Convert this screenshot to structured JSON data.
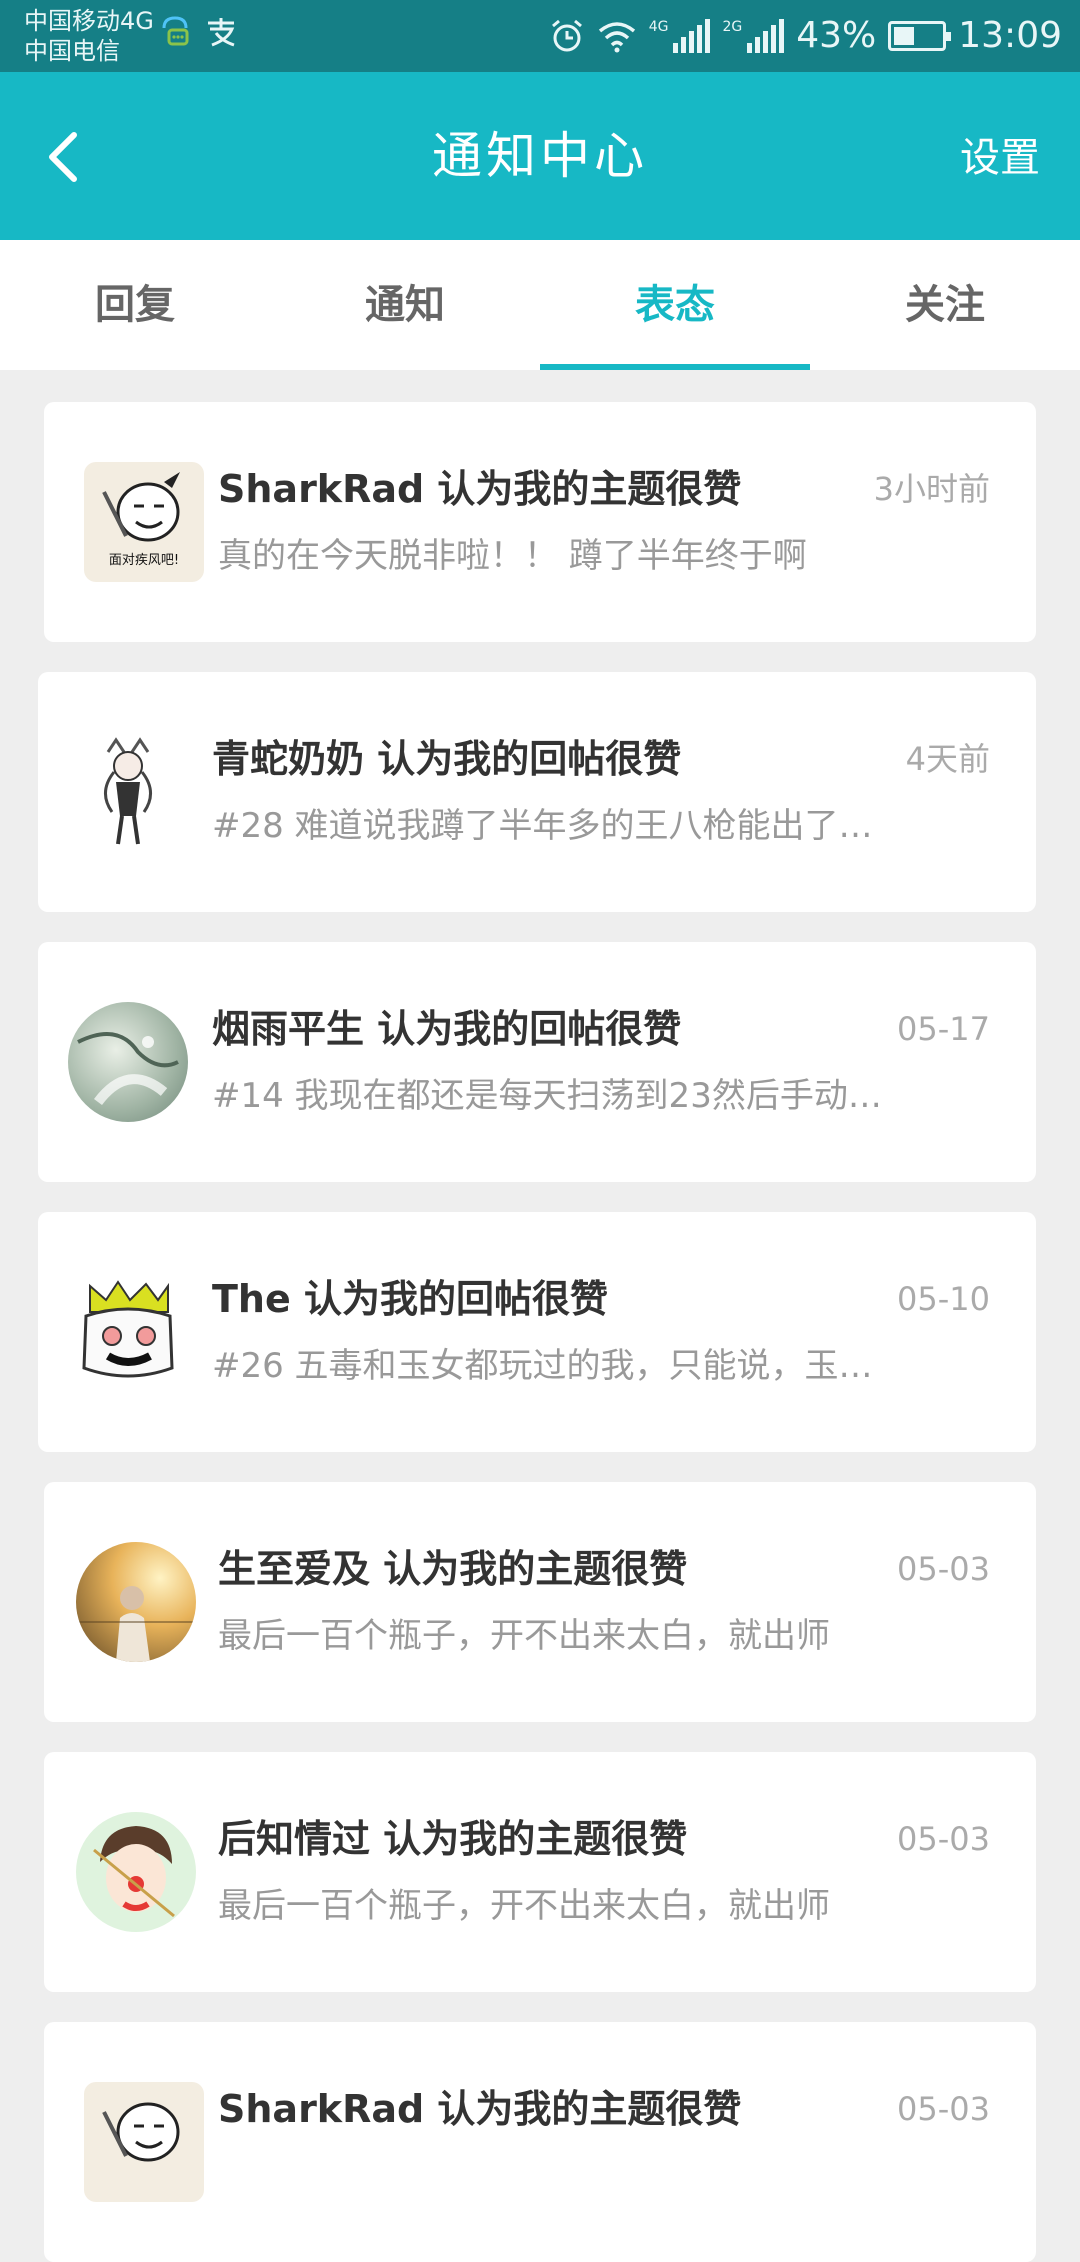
{
  "status_bar": {
    "carrier_1": "中国移动4G",
    "carrier_2": "中国电信",
    "battery": "43%",
    "time": "13:09",
    "battery_level": 0.43,
    "icons": [
      "chat-icon",
      "alipay-icon",
      "alarm-icon",
      "wifi-icon",
      "signal-4g-icon",
      "signal-2g-icon",
      "battery-icon"
    ]
  },
  "header": {
    "title": "通知中心",
    "settings_label": "设置",
    "background": "#17b8c5"
  },
  "tabs": [
    {
      "label": "回复",
      "active": false
    },
    {
      "label": "通知",
      "active": false
    },
    {
      "label": "表态",
      "active": true
    },
    {
      "label": "关注",
      "active": false
    }
  ],
  "accent_color": "#17b8c5",
  "notifications": [
    {
      "name": "SharkRad 认为我的主题很赞",
      "time": "3小时前",
      "message": "真的在今天脱非啦！！ 蹲了半年终于啊",
      "avatar": "rage-comic-avatar",
      "avatar_caption": "面对疾风吧!"
    },
    {
      "name": "青蛇奶奶 认为我的回帖很赞",
      "time": "4天前",
      "message": "#28 难道说我蹲了半年多的王八枪能出了…",
      "avatar": "snake-girl-avatar"
    },
    {
      "name": "烟雨平生 认为我的回帖很赞",
      "time": "05-17",
      "message": "#14 我现在都还是每天扫荡到23然后手动…",
      "avatar": "painting-avatar"
    },
    {
      "name": "The 认为我的回帖很赞",
      "time": "05-10",
      "message": "#26 五毒和玉女都玩过的我，只能说，玉…",
      "avatar": "crown-ghost-avatar"
    },
    {
      "name": "生至爱及 认为我的主题很赞",
      "time": "05-03",
      "message": "最后一百个瓶子，开不出来太白，就出师",
      "avatar": "sunset-girl-avatar"
    },
    {
      "name": "后知情过 认为我的主题很赞",
      "time": "05-03",
      "message": "最后一百个瓶子，开不出来太白，就出师",
      "avatar": "clown-boy-avatar"
    },
    {
      "name": "SharkRad 认为我的主题很赞",
      "time": "05-03",
      "message": "",
      "avatar": "rage-comic-avatar"
    }
  ]
}
